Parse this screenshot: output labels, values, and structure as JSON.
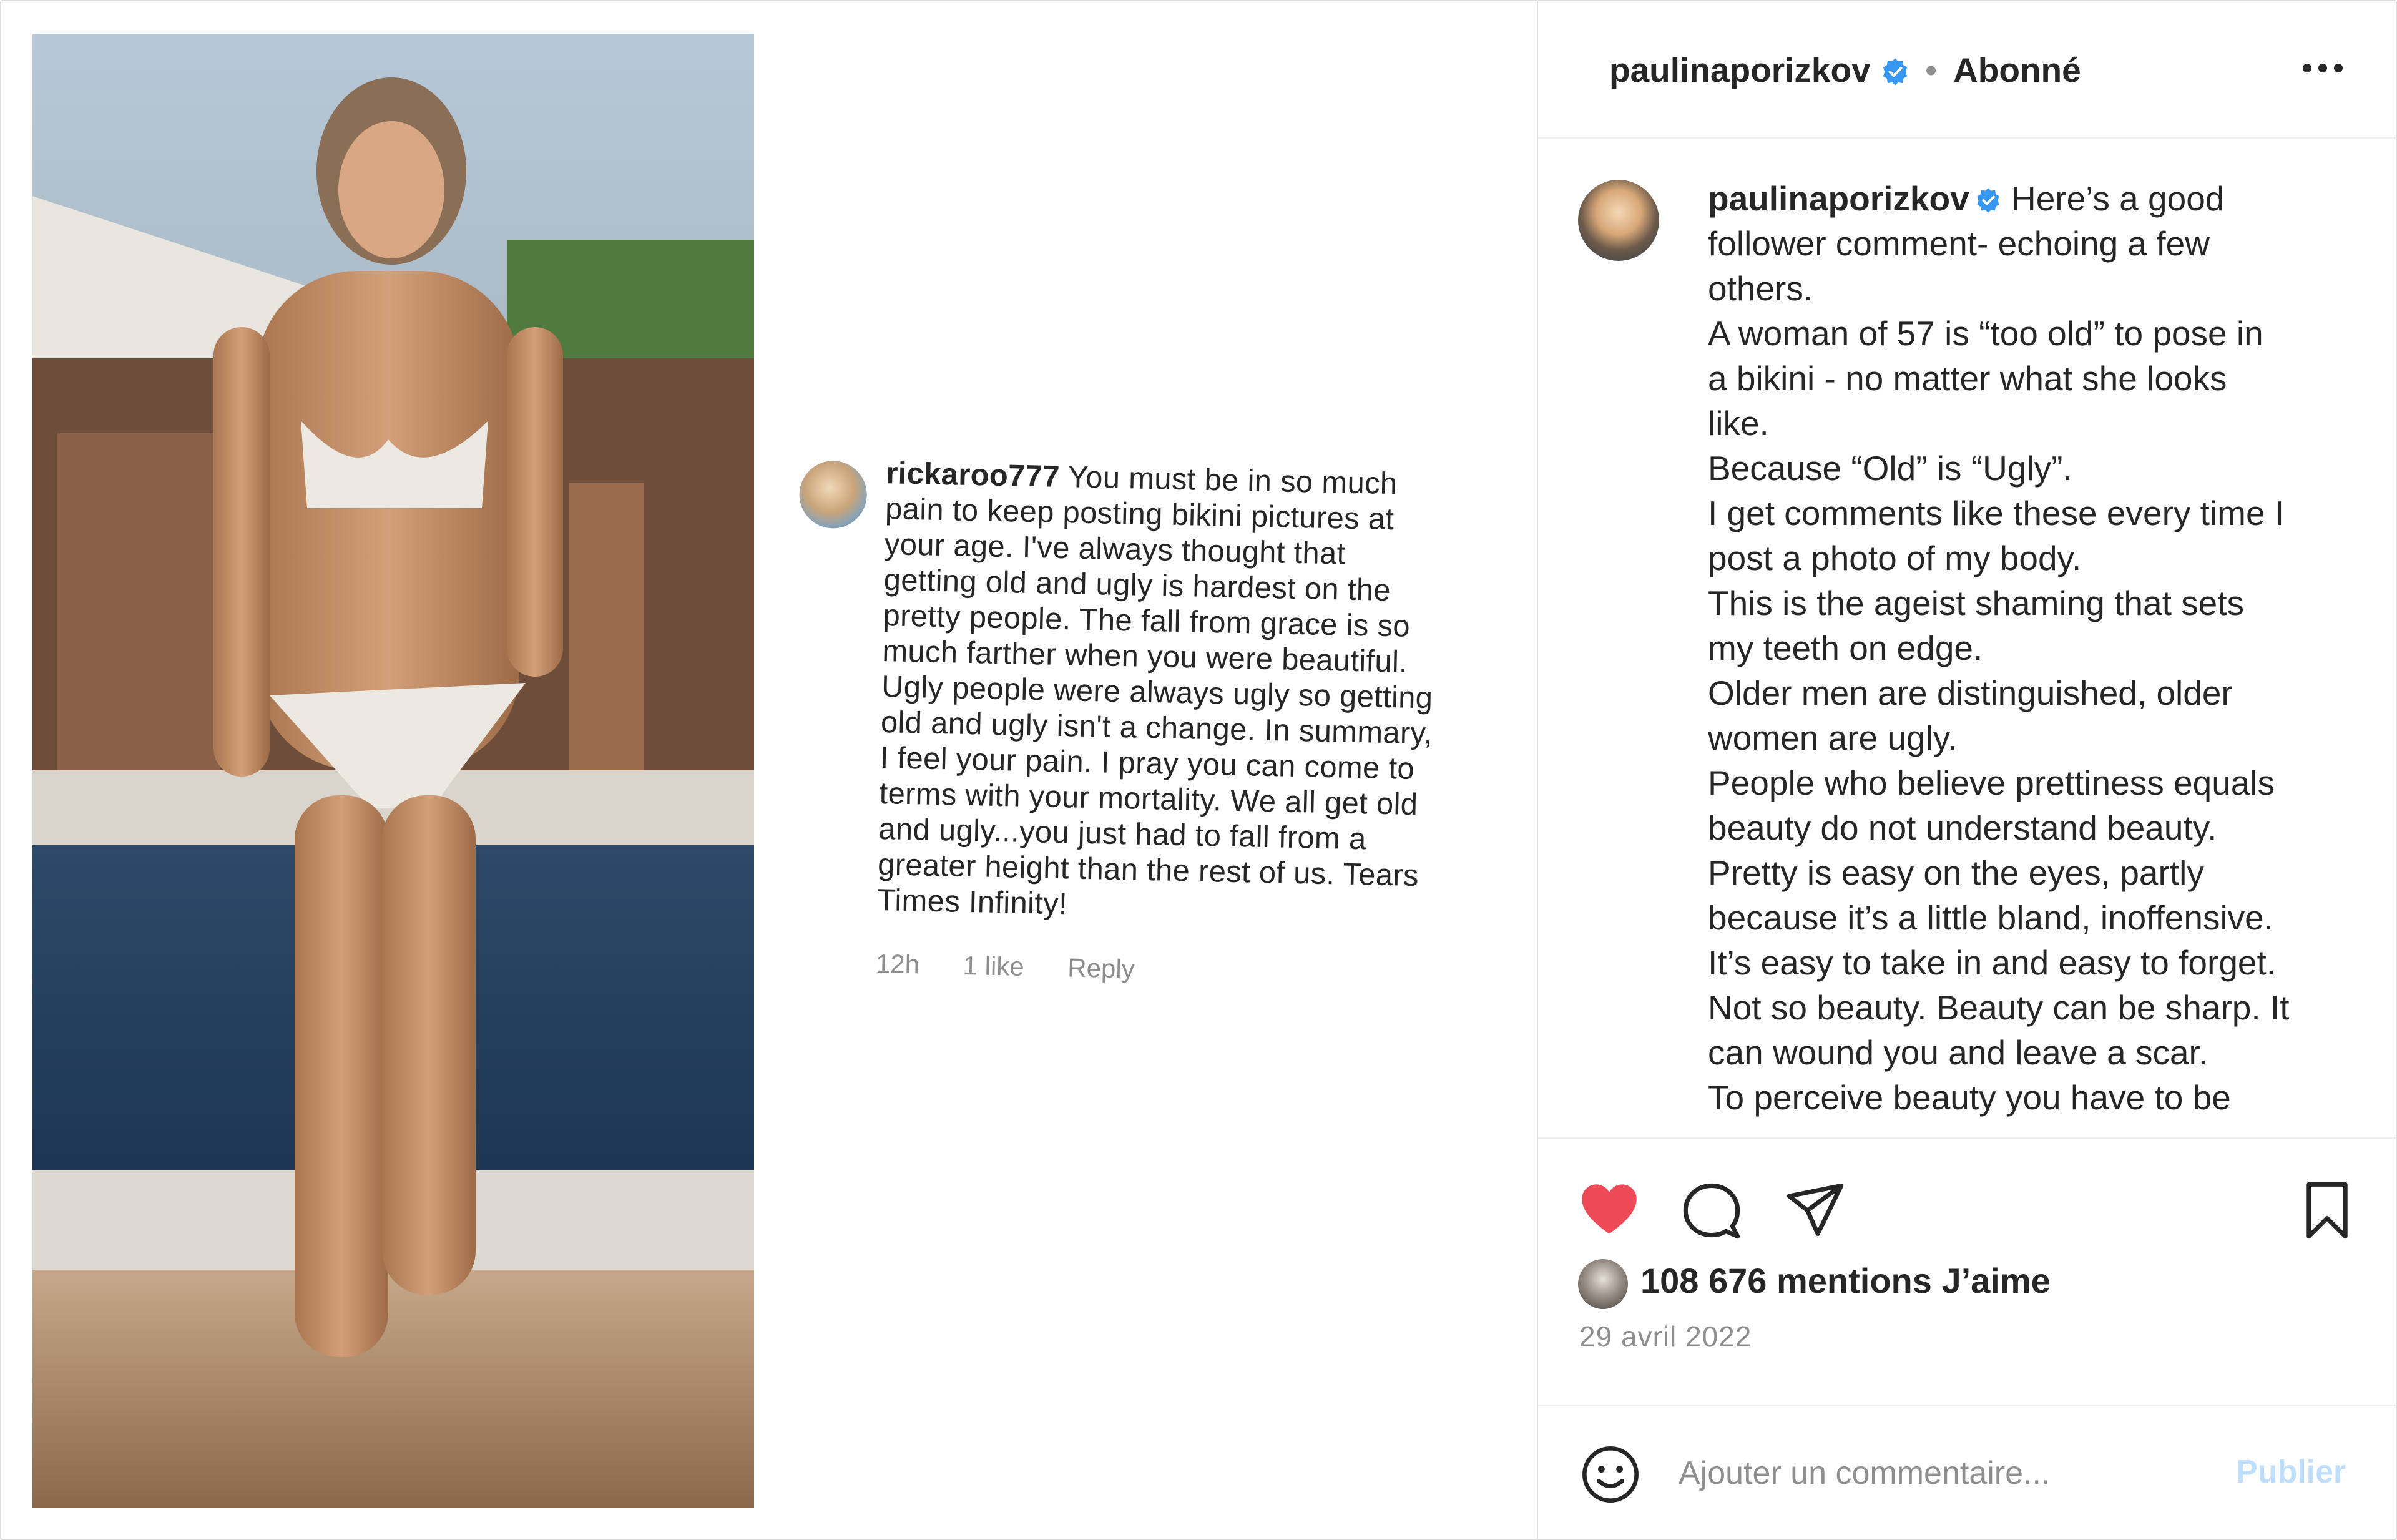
{
  "media": {
    "photo_alt": "",
    "screenshot_comment": {
      "username": "rickaroo777",
      "lines": [
        " You must be in so much",
        "pain to keep posting bikini pictures at",
        "your age.  I've always thought that",
        "getting old and ugly is hardest on the",
        "pretty people.  The fall from grace is so",
        "much farther when you were beautiful.",
        "Ugly people were always ugly so getting",
        "old and ugly isn't a change.  In summary,",
        "I feel your pain.  I pray you can come to",
        "terms with your mortality.  We all get old",
        "and ugly...you just had to fall from a",
        "greater height than the rest of us.  Tears",
        "Times Infinity!"
      ],
      "time": "12h",
      "likes": "1 like",
      "reply": "Reply"
    }
  },
  "header": {
    "username": "paulinaporizkov",
    "separator": "•",
    "follow_status": "Abonné"
  },
  "caption": {
    "username": "paulinaporizkov",
    "first_line": " Here’s a good",
    "lines": [
      "follower comment- echoing a few",
      "others.",
      "A woman of 57 is “too old” to pose in",
      "a bikini - no matter what she looks",
      "like.",
      "Because “Old” is “Ugly”.",
      "I get comments like these every time I",
      "post a photo of my body.",
      "This is the ageist shaming that sets",
      "my teeth on edge.",
      "Older men are distinguished, older",
      "women are ugly.",
      "People who believe prettiness equals",
      "beauty do not understand beauty.",
      "Pretty is easy on the eyes, partly",
      "because it’s a little bland, inoffensive.",
      "It’s easy to take in and easy to forget.",
      "Not so beauty. Beauty can be sharp. It",
      "can wound you and leave a scar.",
      "To perceive beauty you have to be"
    ]
  },
  "actions": {
    "liked": true,
    "like_color": "#ed4956",
    "likes_text": "108 676 mentions J’aime",
    "date": "29 avril 2022"
  },
  "comment_box": {
    "placeholder": "Ajouter un commentaire...",
    "publish_label": "Publier"
  },
  "colors": {
    "verified": "#3897f0",
    "muted": "#8e8e8e",
    "publish_disabled": "#c0dffd"
  }
}
